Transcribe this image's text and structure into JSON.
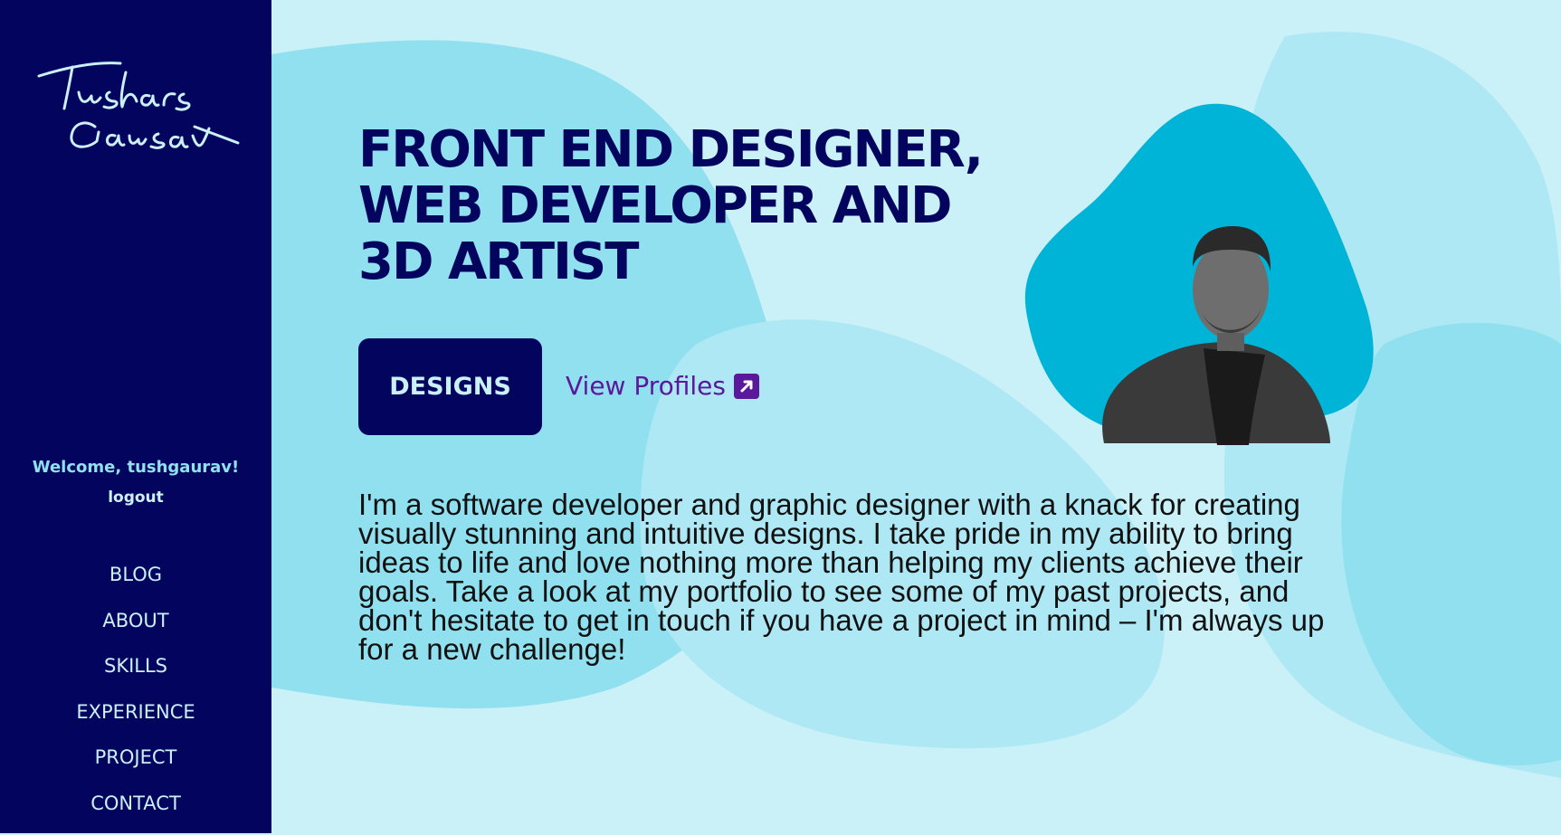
{
  "sidebar": {
    "logo_text": "Tushar Gaurav",
    "welcome": "Welcome, tushgaurav!",
    "logout": "logout",
    "nav": [
      "BLOG",
      "ABOUT",
      "SKILLS",
      "EXPERIENCE",
      "PROJECT",
      "CONTACT"
    ]
  },
  "hero": {
    "headline": "FRONT END DESIGNER,\nWEB DEVELOPER AND\n3D ARTIST",
    "designs_button": "DESIGNS",
    "view_profiles": "View Profiles",
    "about": "I'm a software developer and graphic designer with a knack for creating visually stunning and intuitive designs. I take pride in my ability to bring ideas to life and love nothing more than helping my clients achieve their goals. Take a look at my portfolio to see some of my past projects, and don't hesitate to get in touch if you have a project in mind – I'm always up for a new challenge!"
  },
  "icons": {
    "external_link": "arrow-up-right-box-icon",
    "profile_photo": "profile-photo"
  },
  "colors": {
    "sidebar_bg": "#03045e",
    "page_bg": "#caf0f8",
    "blob_light": "#90e0ef",
    "photo_blob": "#00b4d8",
    "accent_purple": "#5a189a",
    "headline": "#03045e"
  }
}
